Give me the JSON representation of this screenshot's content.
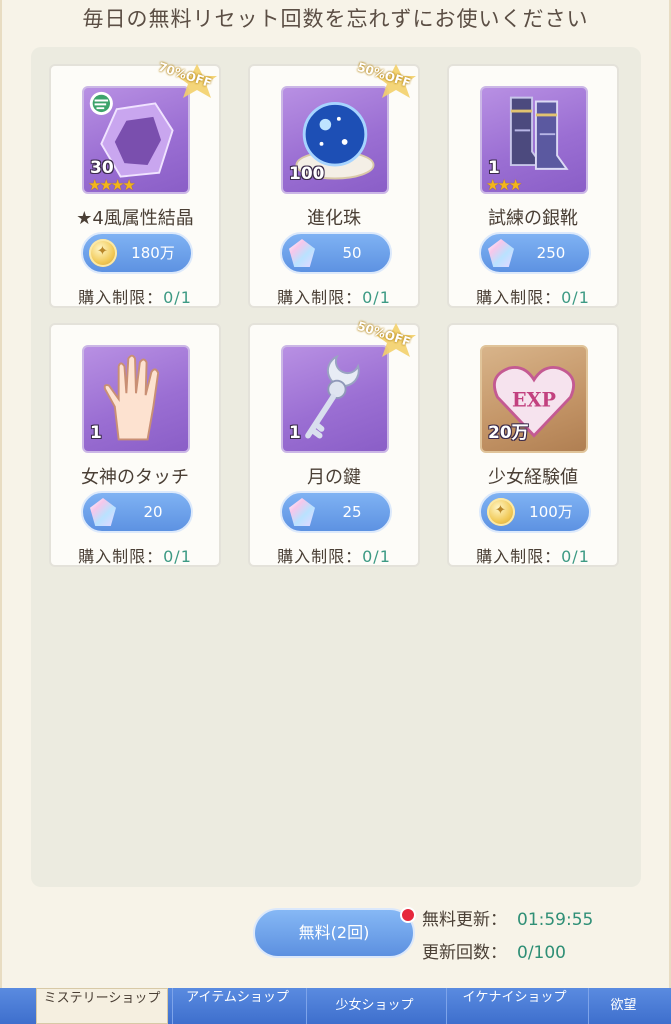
{
  "header": {
    "notice": "毎日の無料リセット回数を忘れずにお使いください"
  },
  "items": [
    {
      "name": "★4風属性結晶",
      "qty": "30",
      "stars": "★★★★",
      "badge": "70%OFF",
      "currency": "coin",
      "price": "180万",
      "limit_label": "購入制限：",
      "limit_value": "0/1",
      "icon": "wind-crystal-icon"
    },
    {
      "name": "進化珠",
      "qty": "100",
      "stars": "",
      "badge": "50%OFF",
      "currency": "gem",
      "price": "50",
      "limit_label": "購入制限：",
      "limit_value": "0/1",
      "icon": "evolution-orb-icon"
    },
    {
      "name": "試練の銀靴",
      "qty": "1",
      "stars": "★★★",
      "badge": "",
      "currency": "gem",
      "price": "250",
      "limit_label": "購入制限：",
      "limit_value": "0/1",
      "icon": "silver-boots-icon"
    },
    {
      "name": "女神のタッチ",
      "qty": "1",
      "stars": "",
      "badge": "",
      "currency": "gem",
      "price": "20",
      "limit_label": "購入制限：",
      "limit_value": "0/1",
      "icon": "hand-icon"
    },
    {
      "name": "月の鍵",
      "qty": "1",
      "stars": "",
      "badge": "50%OFF",
      "currency": "gem",
      "price": "25",
      "limit_label": "購入制限：",
      "limit_value": "0/1",
      "icon": "moon-key-icon"
    },
    {
      "name": "少女経験値",
      "qty": "20万",
      "stars": "",
      "badge": "",
      "currency": "coin",
      "price": "100万",
      "limit_label": "購入制限：",
      "limit_value": "0/1",
      "icon": "exp-heart-icon"
    }
  ],
  "footer": {
    "free_button": "無料(2回)",
    "refresh_label": "無料更新：",
    "refresh_time": "01:59:55",
    "count_label": "更新回数：",
    "count_value": "0/100"
  },
  "tabs": [
    {
      "label": "ミステリーショップ",
      "active": true
    },
    {
      "label": "アイテムショップ",
      "active": false
    },
    {
      "label": "少女ショップ",
      "active": false
    },
    {
      "label": "イケナイショップ",
      "active": false
    },
    {
      "label": "欲望",
      "active": false
    }
  ],
  "colors": {
    "accent_blue": "#5d92e2",
    "limit_green": "#3d9a84",
    "badge_gold": "#f3d06a",
    "alert_red": "#e6283c"
  }
}
